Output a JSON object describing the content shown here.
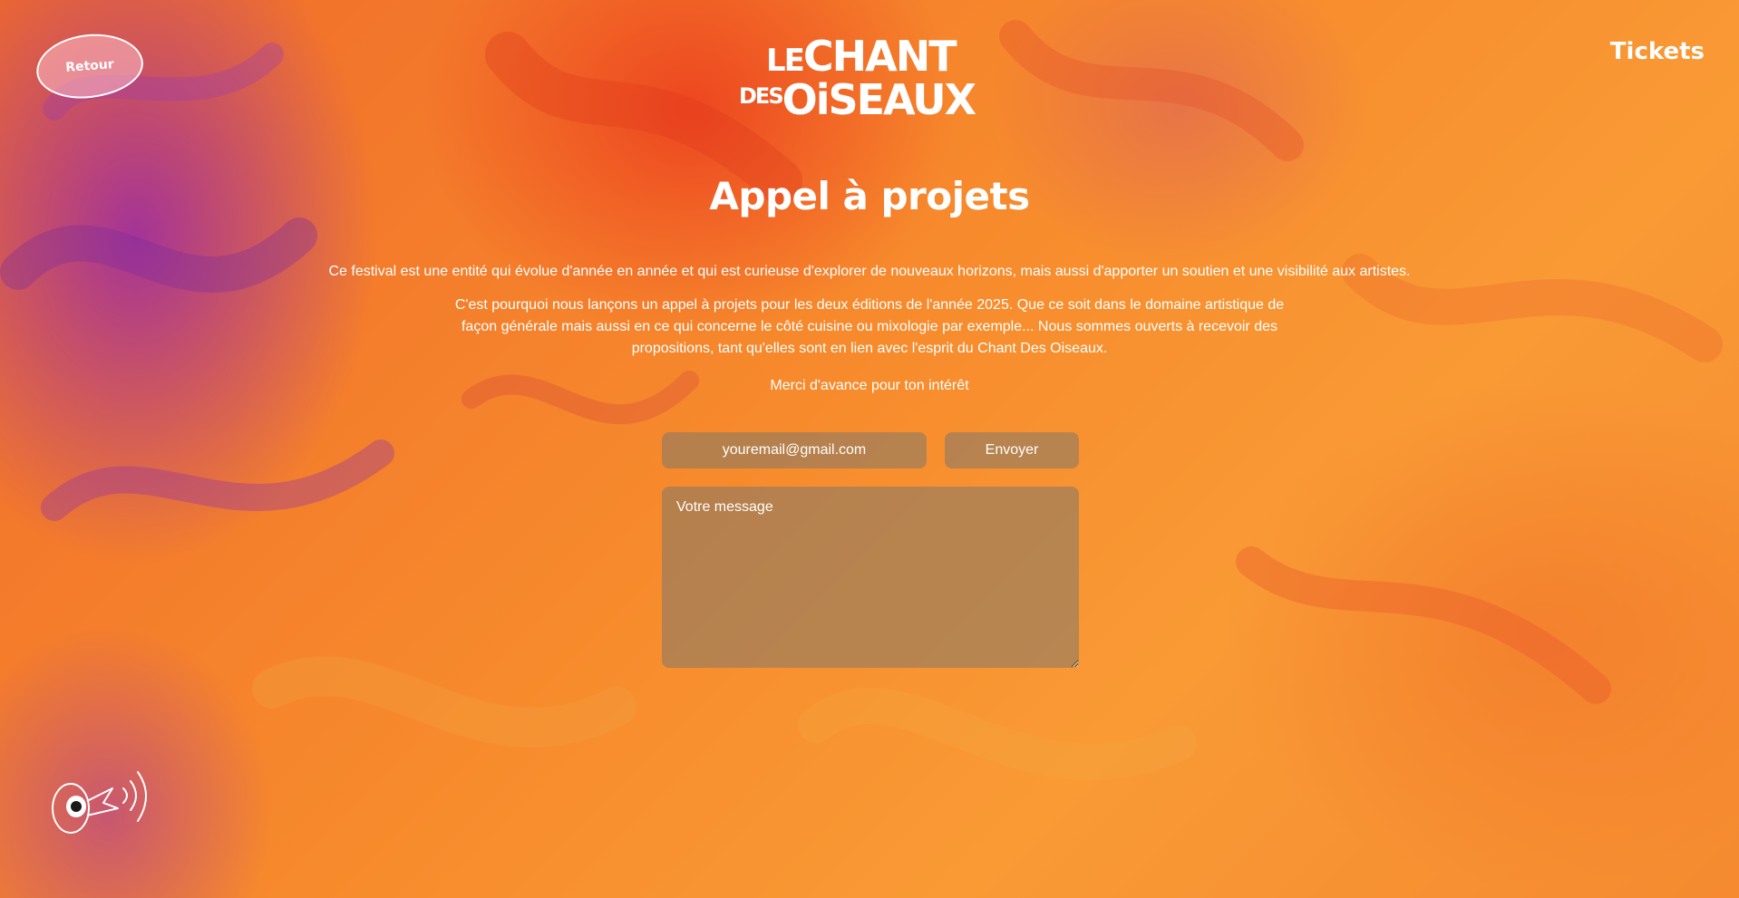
{
  "header": {
    "back_label": "Retour",
    "logo_line1_small": "LE",
    "logo_line1_big": "CHANT",
    "logo_line2_small": "DES",
    "logo_line2_big": "OiSEAUX",
    "tickets_label": "Tickets"
  },
  "main": {
    "title": "Appel à projets",
    "paragraph1": "Ce festival est une entité qui évolue d'année en année et qui est curieuse d'explorer de nouveaux horizons, mais aussi d'apporter un soutien et une visibilité aux artistes.",
    "paragraph2": "C'est pourquoi nous lançons un appel à projets pour les deux éditions de l'année 2025. Que ce soit dans le domaine artistique de façon générale mais aussi en ce qui concerne le côté cuisine ou mixologie par exemple... Nous sommes ouverts à recevoir des propositions, tant qu'elles sont en lien avec l'esprit du Chant Des Oiseaux.",
    "paragraph3": "Merci d'avance pour ton intérêt"
  },
  "form": {
    "email_placeholder": "youremail@gmail.com",
    "send_label": "Envoyer",
    "message_placeholder": "Votre message"
  },
  "icons": {
    "sound": "bird-sound-icon"
  },
  "colors": {
    "background_primary": "#f78a2c",
    "background_accent_red": "#eb3c1e",
    "background_accent_purple": "#9628aa",
    "field_background": "#827869",
    "text": "#ffffff"
  }
}
